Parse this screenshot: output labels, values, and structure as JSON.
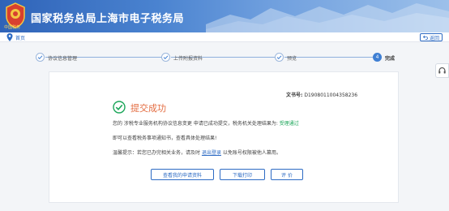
{
  "header": {
    "title": "国家税务总局上海市电子税务局",
    "emblem_label": "中国税务"
  },
  "subbar": {
    "home": "首页",
    "return_label": "返回"
  },
  "steps": [
    {
      "label": "协议信息管理",
      "state": "done"
    },
    {
      "label": "上传附报资料",
      "state": "done"
    },
    {
      "label": "预览",
      "state": "done"
    },
    {
      "label": "完成",
      "number": "4",
      "state": "active"
    }
  ],
  "result": {
    "doc_no_label": "文书号:",
    "doc_no_value": "D1908011004358236",
    "success_title": "提交成功",
    "message_prefix": "您的 涉税专业服务机构协议信息变更 申请已成功提交，税务机关处理结果为:",
    "message_status": "受理通过",
    "notice": "即可以查看税务事项通知书，查看具体处理结果!",
    "tip_prefix": "温馨提示：若您已办完相关业务，请及时",
    "tip_link": "退出登录",
    "tip_suffix": "以免账号权限被他人篡用。"
  },
  "buttons": {
    "view_application": "查看我的申请资料",
    "download_print": "下载打印",
    "evaluate": "评 价"
  },
  "colors": {
    "header_blue": "#2f63b8",
    "accent_blue": "#2d6bc4",
    "success_green": "#1aa558",
    "success_text": "#e36b3f"
  }
}
